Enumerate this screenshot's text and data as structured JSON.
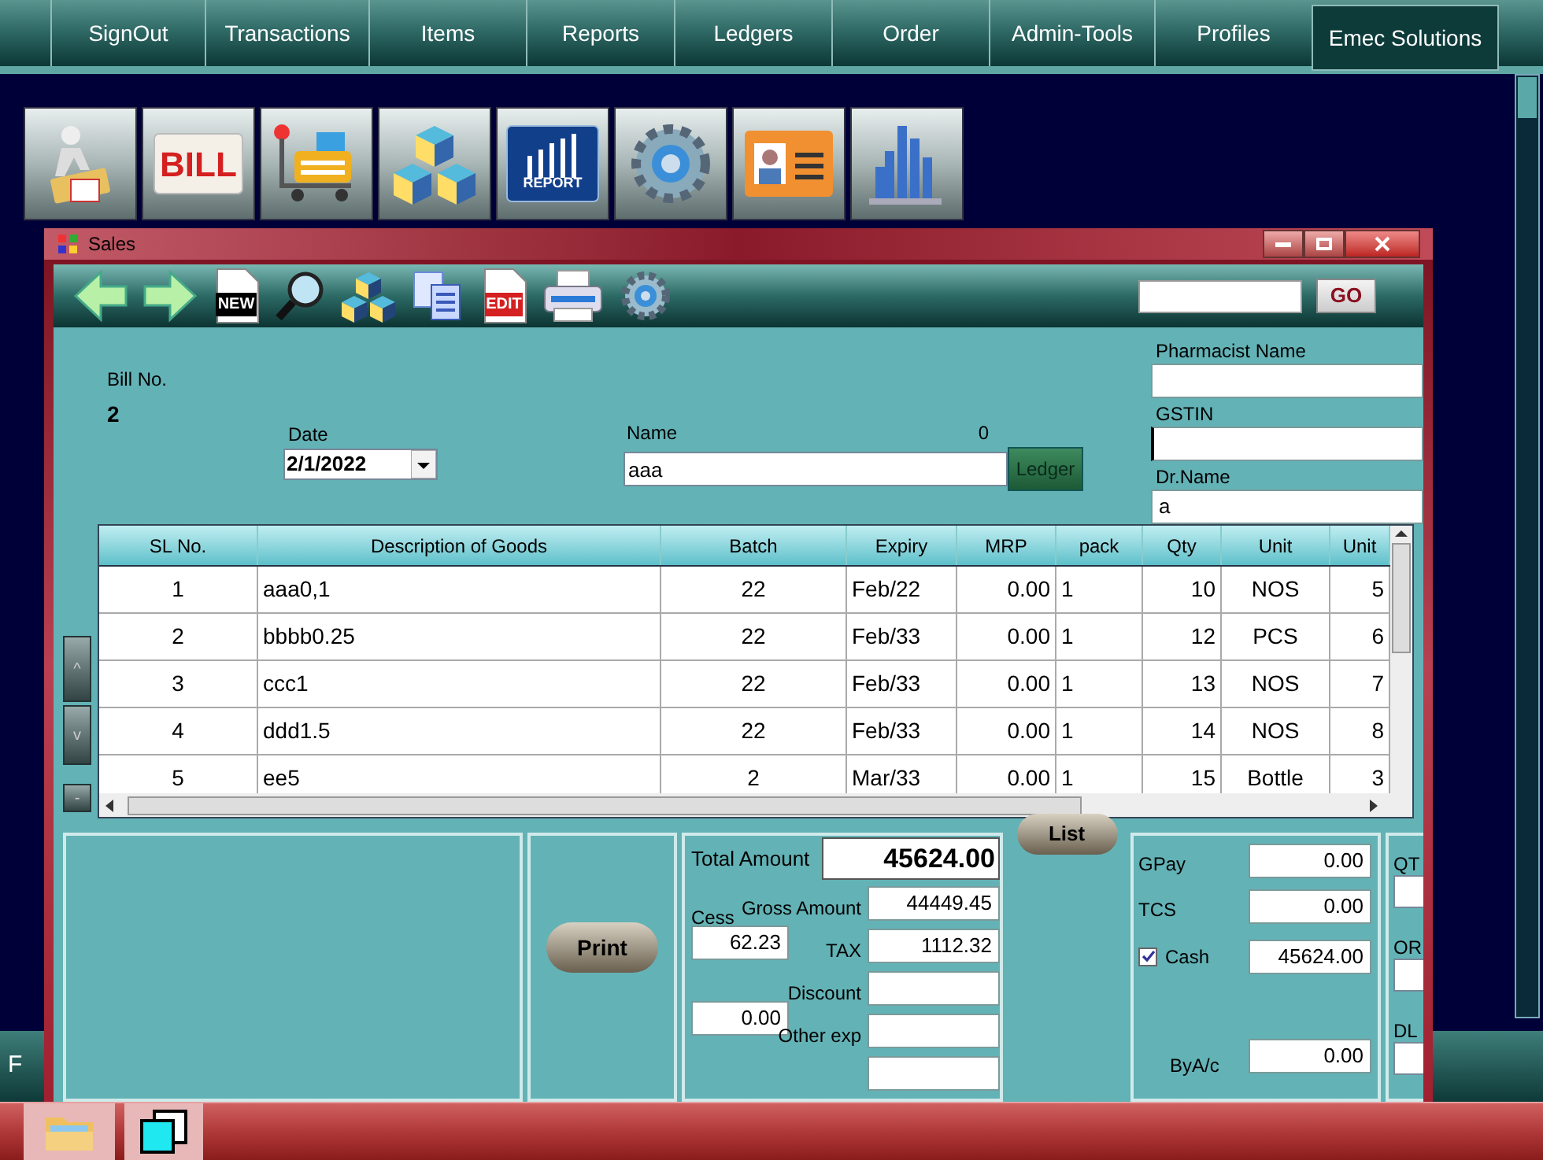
{
  "menu": [
    {
      "label": "SignOut",
      "selected": false
    },
    {
      "label": "Transactions",
      "selected": false
    },
    {
      "label": "Items",
      "selected": false
    },
    {
      "label": "Reports",
      "selected": false
    },
    {
      "label": "Ledgers",
      "selected": false
    },
    {
      "label": "Order",
      "selected": false
    },
    {
      "label": "Admin-Tools",
      "selected": false
    },
    {
      "label": "Profiles",
      "selected": false
    },
    {
      "label": "Emec Solutions",
      "selected": true
    }
  ],
  "launcher": [
    {
      "kind": "person"
    },
    {
      "kind": "bill",
      "text": "BILL"
    },
    {
      "kind": "cart"
    },
    {
      "kind": "cubes"
    },
    {
      "kind": "report",
      "text": "REPORT"
    },
    {
      "kind": "gear"
    },
    {
      "kind": "contact"
    },
    {
      "kind": "chart"
    }
  ],
  "window": {
    "title": "Sales"
  },
  "toolbar": [
    {
      "kind": "back"
    },
    {
      "kind": "forward"
    },
    {
      "kind": "doc",
      "text": "NEW"
    },
    {
      "kind": "search"
    },
    {
      "kind": "cubes"
    },
    {
      "kind": "copy"
    },
    {
      "kind": "doc",
      "text": "EDIT"
    },
    {
      "kind": "print"
    },
    {
      "kind": "gear"
    }
  ],
  "go_button": "GO",
  "bill": {
    "label": "Bill No.",
    "value": "2"
  },
  "date": {
    "label": "Date",
    "value": "2/1/2022"
  },
  "name": {
    "label": "Name",
    "count": "0",
    "value": "aaa",
    "button": "Ledger"
  },
  "pharmacist": {
    "label": "Pharmacist Name"
  },
  "gstin": {
    "label": "GSTIN"
  },
  "doctor": {
    "label": "Dr.Name",
    "value": "a"
  },
  "side_buttons": [
    "^",
    "v",
    "-"
  ],
  "table": {
    "columns": [
      "SL No.",
      "Description of Goods",
      "Batch",
      "Expiry",
      "MRP",
      "pack",
      "Qty",
      "Unit",
      "Unit"
    ],
    "rows": [
      [
        "1",
        "aaa0,1",
        "22",
        "Feb/22",
        "0.00",
        "1",
        "10",
        "NOS",
        "5"
      ],
      [
        "2",
        "bbbb0.25",
        "22",
        "Feb/33",
        "0.00",
        "1",
        "12",
        "PCS",
        "6"
      ],
      [
        "3",
        "ccc1",
        "22",
        "Feb/33",
        "0.00",
        "1",
        "13",
        "NOS",
        "7"
      ],
      [
        "4",
        "ddd1.5",
        "22",
        "Feb/33",
        "0.00",
        "1",
        "14",
        "NOS",
        "8"
      ],
      [
        "5",
        "ee5",
        "2",
        "Mar/33",
        "0.00",
        "1",
        "15",
        "Bottle",
        "3"
      ]
    ]
  },
  "print_button": "Print",
  "totals": {
    "total": {
      "label": "Total Amount",
      "value": "45624.00"
    },
    "cess": {
      "label": "Cess",
      "value": "62.23"
    },
    "extra_value": "0.00",
    "lines": [
      {
        "label": "Gross Amount",
        "value": "44449.45"
      },
      {
        "label": "TAX",
        "value": "1112.32"
      },
      {
        "label": "Discount"
      },
      {
        "label": "Other exp"
      }
    ]
  },
  "list_button": "List",
  "payments": [
    {
      "kind": "field",
      "label": "GPay",
      "value": "0.00"
    },
    {
      "kind": "field",
      "label": "TCS",
      "value": "0.00"
    },
    {
      "kind": "checkbox",
      "label": "Cash",
      "checked": true,
      "value": "45624.00"
    },
    {
      "kind": "field",
      "label": "ByA/c",
      "value": "0.00"
    }
  ],
  "right_fields": [
    {
      "label": "QT"
    },
    {
      "label": "OR"
    },
    {
      "label": "DL"
    }
  ],
  "background_bar": {
    "text": "F"
  }
}
